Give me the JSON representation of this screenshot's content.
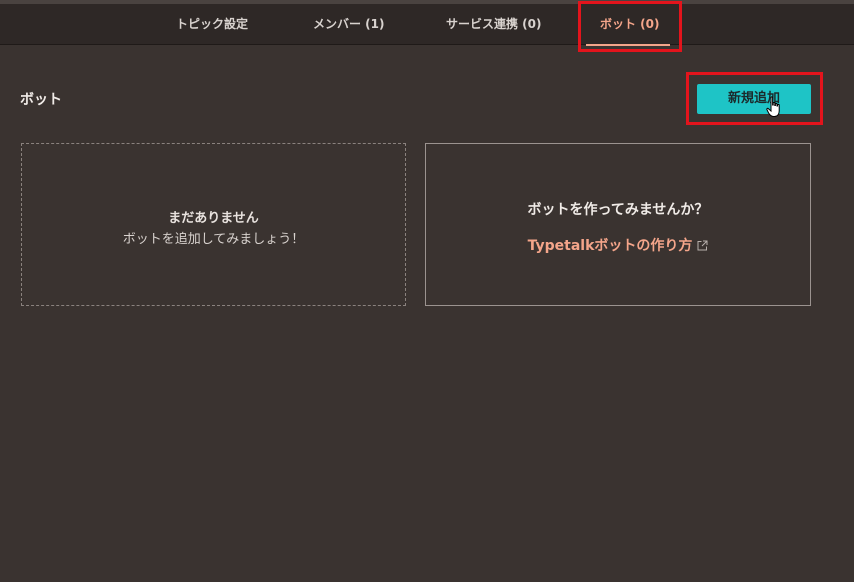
{
  "tabs": [
    {
      "label": "トピック設定"
    },
    {
      "label": "メンバー (1)"
    },
    {
      "label": "サービス連携 (0)"
    },
    {
      "label": "ボット (0)",
      "active": true
    }
  ],
  "section": {
    "title": "ボット",
    "add_button_label": "新規追加"
  },
  "empty_state": {
    "title": "まだありません",
    "subtitle": "ボットを追加してみましょう！"
  },
  "info_card": {
    "title": "ボットを作ってみませんか？",
    "link_label": "Typetalkボットの作り方",
    "link_icon": "external-link-icon"
  },
  "colors": {
    "background": "#3a3330",
    "tabbar": "#2e2826",
    "accent_orange": "#f4a58a",
    "button_teal": "#1ec4c6",
    "highlight_red": "#e3141c"
  }
}
